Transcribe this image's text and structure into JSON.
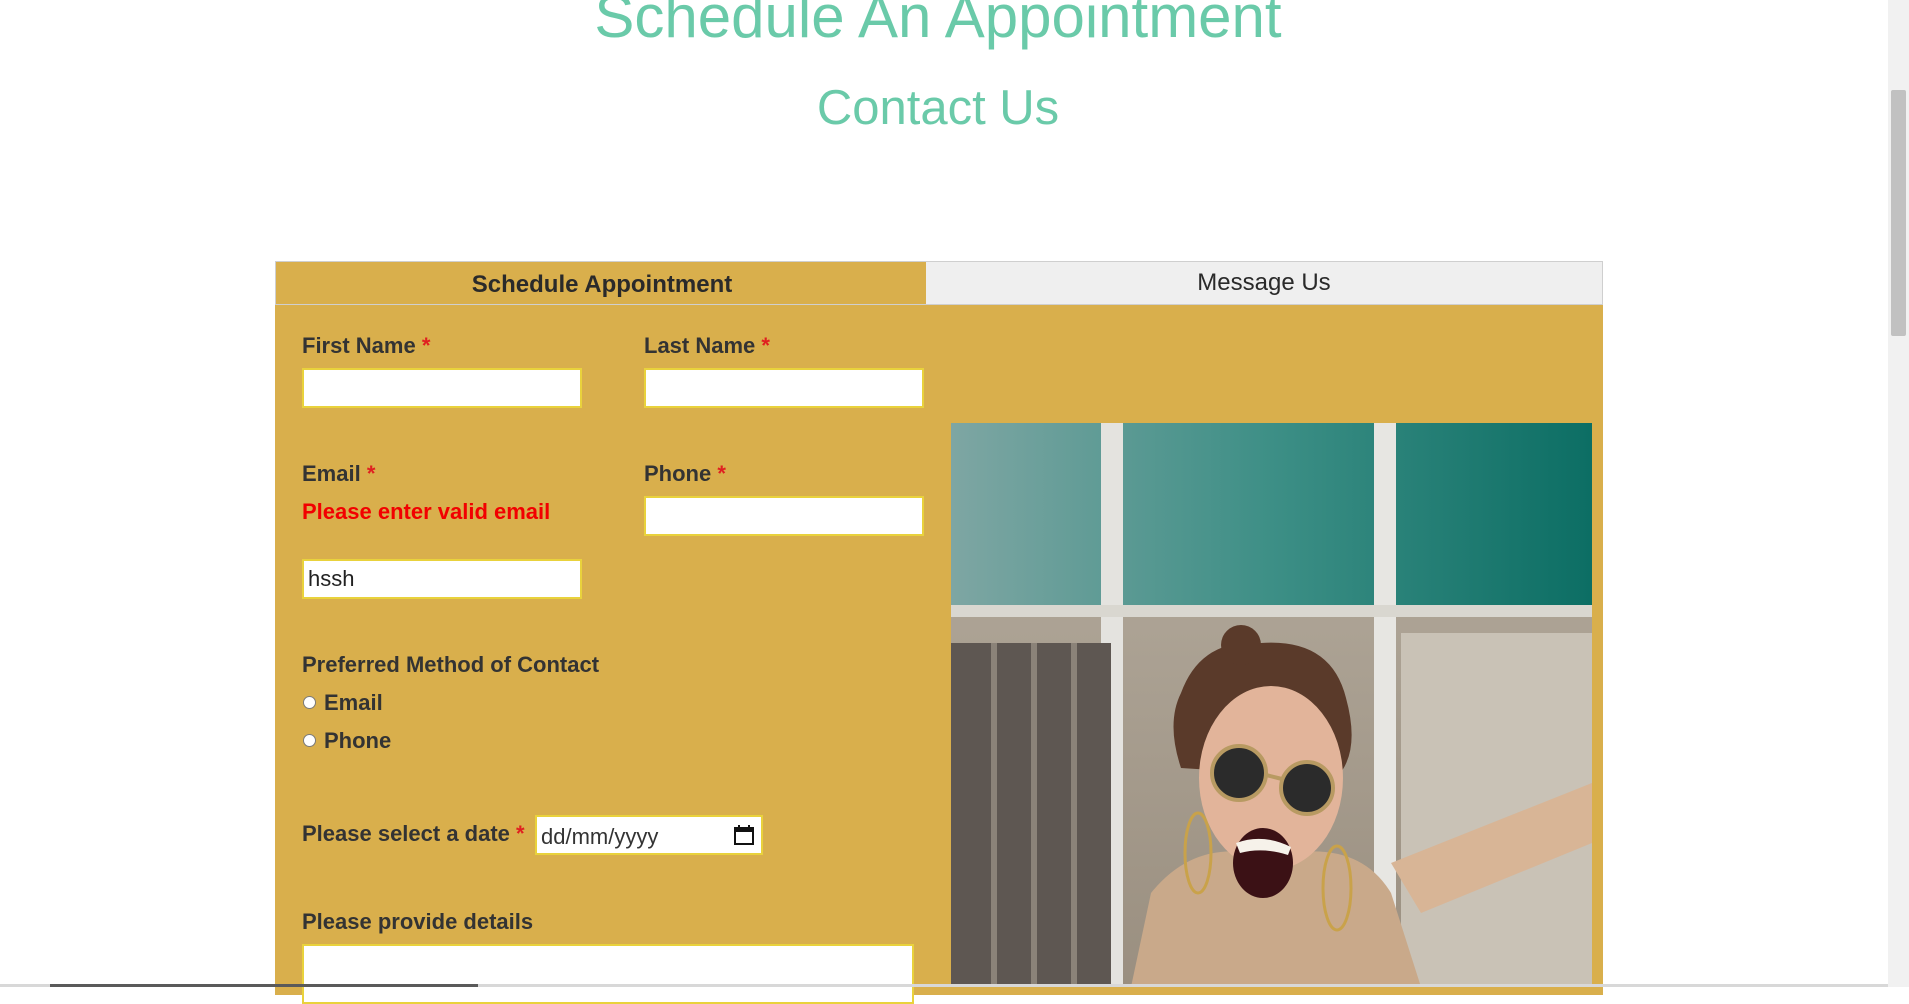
{
  "page": {
    "title": "Schedule An Appointment",
    "subtitle": "Contact Us"
  },
  "tabs": [
    {
      "label": "Schedule Appointment",
      "active": true
    },
    {
      "label": "Message Us",
      "active": false
    }
  ],
  "form": {
    "first_name": {
      "label": "First Name",
      "required_mark": "*",
      "value": ""
    },
    "last_name": {
      "label": "Last Name",
      "required_mark": "*",
      "value": ""
    },
    "email": {
      "label": "Email",
      "required_mark": "*",
      "error": "Please enter valid email",
      "value": "hssh"
    },
    "phone": {
      "label": "Phone",
      "required_mark": "*",
      "value": ""
    },
    "contact_method": {
      "label": "Preferred Method of Contact",
      "options": [
        "Email",
        "Phone"
      ]
    },
    "date": {
      "label": "Please select a date",
      "required_mark": "*",
      "placeholder": "dd/mm/yyyy"
    },
    "details": {
      "label": "Please provide details",
      "value": ""
    }
  },
  "colors": {
    "heading": "#6acaa9",
    "panel": "#d9af4c",
    "input_border": "#e9d23c",
    "error": "#f20000"
  },
  "icons": {
    "date_picker": "calendar-icon"
  }
}
